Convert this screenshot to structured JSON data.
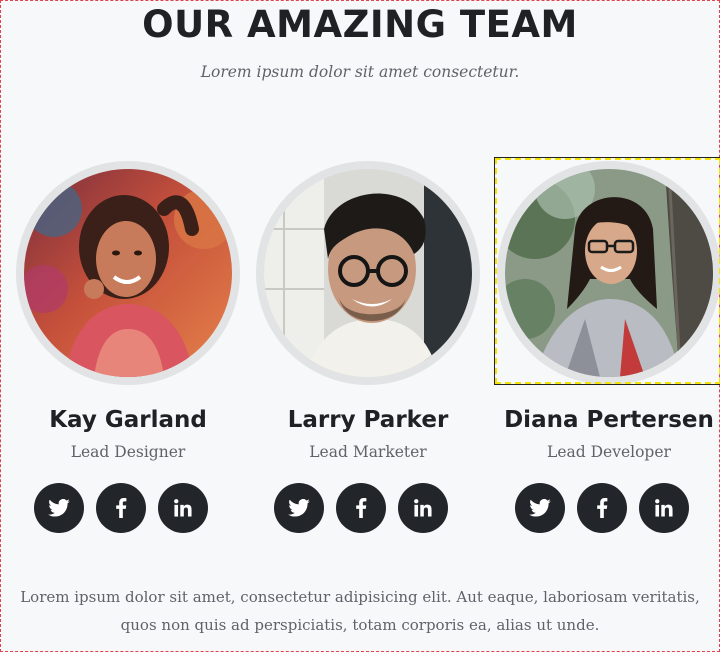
{
  "section": {
    "title": "OUR AMAZING TEAM",
    "subtitle": "Lorem ipsum dolor sit amet consectetur.",
    "footer_line1": "Lorem ipsum dolor sit amet, consectetur adipisicing elit. Aut eaque, laboriosam veritatis,",
    "footer_line2": "quos non quis ad perspiciatis, totam corporis ea, alias ut unde."
  },
  "team": [
    {
      "name": "Kay Garland",
      "role": "Lead Designer",
      "social": {
        "twitter": "twitter-icon",
        "facebook": "facebook-icon",
        "linkedin": "linkedin-icon"
      }
    },
    {
      "name": "Larry Parker",
      "role": "Lead Marketer",
      "social": {
        "twitter": "twitter-icon",
        "facebook": "facebook-icon",
        "linkedin": "linkedin-icon"
      }
    },
    {
      "name": "Diana Pertersen",
      "role": "Lead Developer",
      "social": {
        "twitter": "twitter-icon",
        "facebook": "facebook-icon",
        "linkedin": "linkedin-icon"
      }
    }
  ],
  "colors": {
    "background": "#f7f8fa",
    "heading": "#202124",
    "muted_text": "#5f6368",
    "social_button": "#22252a",
    "avatar_ring": "#e2e3e5",
    "selection_outline": "#f5e400",
    "page_border": "#e0434f"
  }
}
